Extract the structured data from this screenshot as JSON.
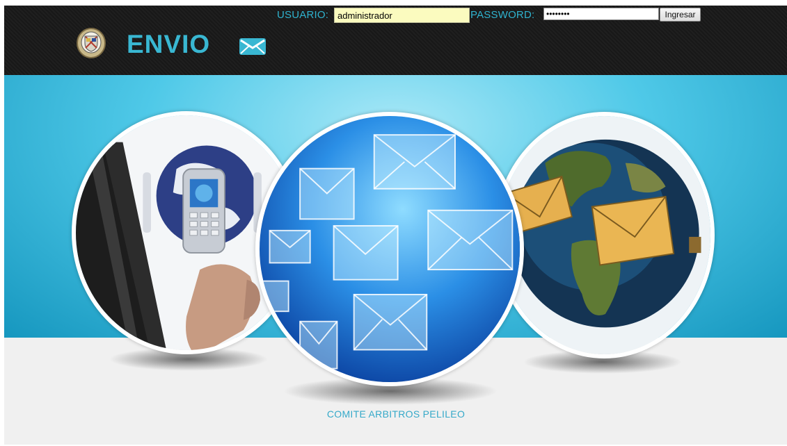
{
  "login": {
    "user_label": "USUARIO:",
    "user_value": "administrador",
    "password_label": "PASSWORD:",
    "password_value": "administ",
    "submit_label": "Ingresar"
  },
  "brand": {
    "name": "ENVIO",
    "emblem_icon": "coat-of-arms-icon",
    "mail_icon": "envelope-icon",
    "accent_color": "#39b7d2"
  },
  "hero": {
    "images": [
      "phone-globe-image",
      "email-envelopes-image",
      "earth-envelopes-image"
    ]
  },
  "footer": {
    "text": "COMITE ARBITROS PELILEO"
  }
}
